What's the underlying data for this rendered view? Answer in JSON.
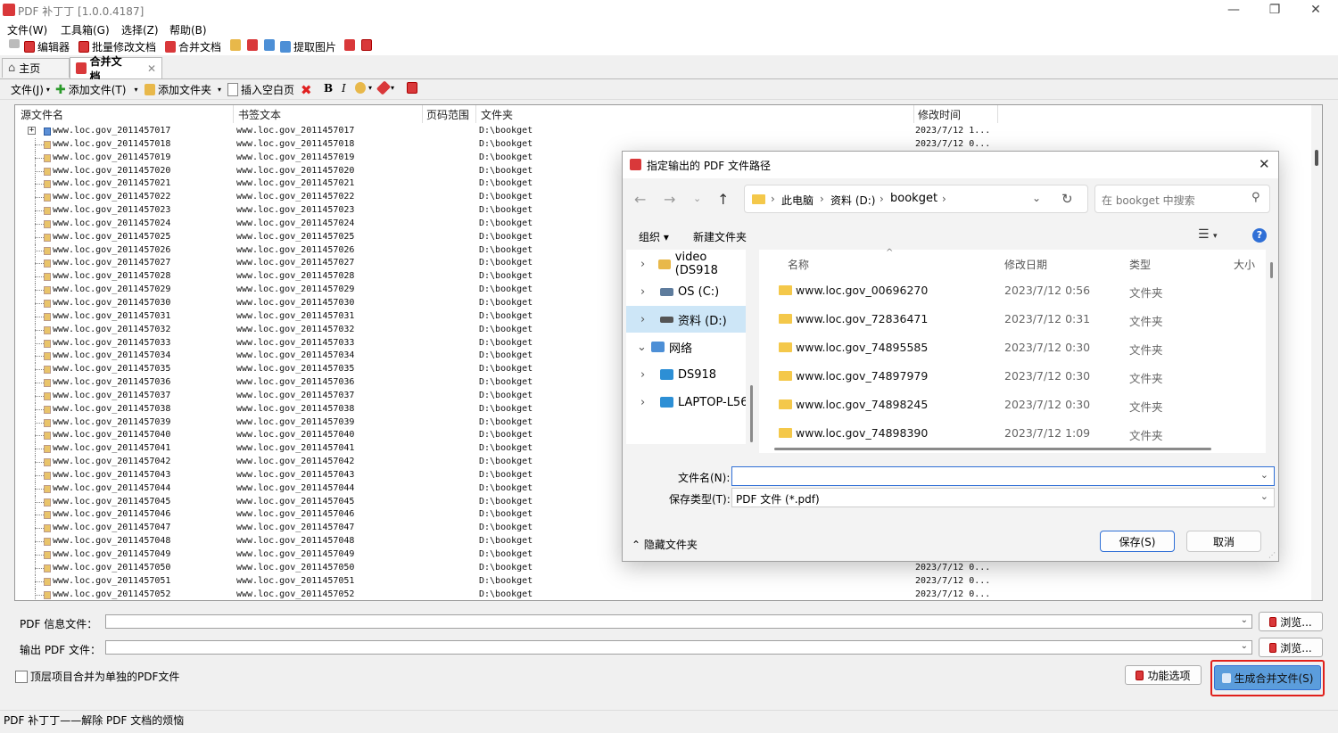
{
  "app": {
    "title": "PDF 补丁丁 [1.0.0.4187]",
    "status": "PDF 补丁丁——解除 PDF 文档的烦恼"
  },
  "menu": [
    "文件(W)",
    "工具箱(G)",
    "选择(Z)",
    "帮助(B)"
  ],
  "toolbar": {
    "editor": "编辑器",
    "batch": "批量修改文档",
    "merge": "合并文档",
    "extract": "提取图片"
  },
  "tabs": {
    "home": "主页",
    "merge": "合并文档"
  },
  "commands": {
    "file": "文件(J)",
    "add_file": "添加文件(T)",
    "add_folder": "添加文件夹",
    "insert_blank": "插入空白页",
    "bold": "B",
    "italic": "I"
  },
  "grid": {
    "headers": {
      "source": "源文件名",
      "bookmark": "书签文本",
      "range": "页码范围",
      "folder": "文件夹",
      "modified": "修改时间"
    },
    "rows": [
      {
        "name": "www.loc.gov_2011457017",
        "bm": "www.loc.gov_2011457017",
        "dir": "D:\\bookget",
        "time": "2023/7/12 1..."
      },
      {
        "name": "www.loc.gov_2011457018",
        "bm": "www.loc.gov_2011457018",
        "dir": "D:\\bookget",
        "time": "2023/7/12 0..."
      },
      {
        "name": "www.loc.gov_2011457019",
        "bm": "www.loc.gov_2011457019",
        "dir": "D:\\bookget",
        "time": ""
      },
      {
        "name": "www.loc.gov_2011457020",
        "bm": "www.loc.gov_2011457020",
        "dir": "D:\\bookget",
        "time": ""
      },
      {
        "name": "www.loc.gov_2011457021",
        "bm": "www.loc.gov_2011457021",
        "dir": "D:\\bookget",
        "time": ""
      },
      {
        "name": "www.loc.gov_2011457022",
        "bm": "www.loc.gov_2011457022",
        "dir": "D:\\bookget",
        "time": ""
      },
      {
        "name": "www.loc.gov_2011457023",
        "bm": "www.loc.gov_2011457023",
        "dir": "D:\\bookget",
        "time": ""
      },
      {
        "name": "www.loc.gov_2011457024",
        "bm": "www.loc.gov_2011457024",
        "dir": "D:\\bookget",
        "time": ""
      },
      {
        "name": "www.loc.gov_2011457025",
        "bm": "www.loc.gov_2011457025",
        "dir": "D:\\bookget",
        "time": ""
      },
      {
        "name": "www.loc.gov_2011457026",
        "bm": "www.loc.gov_2011457026",
        "dir": "D:\\bookget",
        "time": ""
      },
      {
        "name": "www.loc.gov_2011457027",
        "bm": "www.loc.gov_2011457027",
        "dir": "D:\\bookget",
        "time": ""
      },
      {
        "name": "www.loc.gov_2011457028",
        "bm": "www.loc.gov_2011457028",
        "dir": "D:\\bookget",
        "time": ""
      },
      {
        "name": "www.loc.gov_2011457029",
        "bm": "www.loc.gov_2011457029",
        "dir": "D:\\bookget",
        "time": ""
      },
      {
        "name": "www.loc.gov_2011457030",
        "bm": "www.loc.gov_2011457030",
        "dir": "D:\\bookget",
        "time": ""
      },
      {
        "name": "www.loc.gov_2011457031",
        "bm": "www.loc.gov_2011457031",
        "dir": "D:\\bookget",
        "time": ""
      },
      {
        "name": "www.loc.gov_2011457032",
        "bm": "www.loc.gov_2011457032",
        "dir": "D:\\bookget",
        "time": ""
      },
      {
        "name": "www.loc.gov_2011457033",
        "bm": "www.loc.gov_2011457033",
        "dir": "D:\\bookget",
        "time": ""
      },
      {
        "name": "www.loc.gov_2011457034",
        "bm": "www.loc.gov_2011457034",
        "dir": "D:\\bookget",
        "time": ""
      },
      {
        "name": "www.loc.gov_2011457035",
        "bm": "www.loc.gov_2011457035",
        "dir": "D:\\bookget",
        "time": ""
      },
      {
        "name": "www.loc.gov_2011457036",
        "bm": "www.loc.gov_2011457036",
        "dir": "D:\\bookget",
        "time": ""
      },
      {
        "name": "www.loc.gov_2011457037",
        "bm": "www.loc.gov_2011457037",
        "dir": "D:\\bookget",
        "time": ""
      },
      {
        "name": "www.loc.gov_2011457038",
        "bm": "www.loc.gov_2011457038",
        "dir": "D:\\bookget",
        "time": ""
      },
      {
        "name": "www.loc.gov_2011457039",
        "bm": "www.loc.gov_2011457039",
        "dir": "D:\\bookget",
        "time": ""
      },
      {
        "name": "www.loc.gov_2011457040",
        "bm": "www.loc.gov_2011457040",
        "dir": "D:\\bookget",
        "time": ""
      },
      {
        "name": "www.loc.gov_2011457041",
        "bm": "www.loc.gov_2011457041",
        "dir": "D:\\bookget",
        "time": ""
      },
      {
        "name": "www.loc.gov_2011457042",
        "bm": "www.loc.gov_2011457042",
        "dir": "D:\\bookget",
        "time": ""
      },
      {
        "name": "www.loc.gov_2011457043",
        "bm": "www.loc.gov_2011457043",
        "dir": "D:\\bookget",
        "time": ""
      },
      {
        "name": "www.loc.gov_2011457044",
        "bm": "www.loc.gov_2011457044",
        "dir": "D:\\bookget",
        "time": ""
      },
      {
        "name": "www.loc.gov_2011457045",
        "bm": "www.loc.gov_2011457045",
        "dir": "D:\\bookget",
        "time": ""
      },
      {
        "name": "www.loc.gov_2011457046",
        "bm": "www.loc.gov_2011457046",
        "dir": "D:\\bookget",
        "time": ""
      },
      {
        "name": "www.loc.gov_2011457047",
        "bm": "www.loc.gov_2011457047",
        "dir": "D:\\bookget",
        "time": ""
      },
      {
        "name": "www.loc.gov_2011457048",
        "bm": "www.loc.gov_2011457048",
        "dir": "D:\\bookget",
        "time": ""
      },
      {
        "name": "www.loc.gov_2011457049",
        "bm": "www.loc.gov_2011457049",
        "dir": "D:\\bookget",
        "time": ""
      },
      {
        "name": "www.loc.gov_2011457050",
        "bm": "www.loc.gov_2011457050",
        "dir": "D:\\bookget",
        "time": "2023/7/12 0..."
      },
      {
        "name": "www.loc.gov_2011457051",
        "bm": "www.loc.gov_2011457051",
        "dir": "D:\\bookget",
        "time": "2023/7/12 0..."
      },
      {
        "name": "www.loc.gov_2011457052",
        "bm": "www.loc.gov_2011457052",
        "dir": "D:\\bookget",
        "time": "2023/7/12 0..."
      }
    ]
  },
  "bottom": {
    "pdf_info_label": "PDF 信息文件：",
    "output_label": "输出 PDF 文件：",
    "browse": "浏览...",
    "checkbox": "顶层项目合并为单独的PDF文件",
    "options": "功能选项",
    "generate": "生成合并文件(S)"
  },
  "dialog": {
    "title": "指定输出的 PDF 文件路径",
    "path": [
      "此电脑",
      "资料 (D:)",
      "bookget"
    ],
    "search_placeholder": "在 bookget 中搜索",
    "organize": "组织",
    "new_folder": "新建文件夹",
    "nav": [
      "video (DS918",
      "OS (C:)",
      "资料 (D:)",
      "网络",
      "DS918",
      "LAPTOP-L56H"
    ],
    "headers": {
      "name": "名称",
      "date": "修改日期",
      "type": "类型",
      "size": "大小"
    },
    "files": [
      {
        "name": "www.loc.gov_00696270",
        "date": "2023/7/12 0:56",
        "type": "文件夹"
      },
      {
        "name": "www.loc.gov_72836471",
        "date": "2023/7/12 0:31",
        "type": "文件夹"
      },
      {
        "name": "www.loc.gov_74895585",
        "date": "2023/7/12 0:30",
        "type": "文件夹"
      },
      {
        "name": "www.loc.gov_74897979",
        "date": "2023/7/12 0:30",
        "type": "文件夹"
      },
      {
        "name": "www.loc.gov_74898245",
        "date": "2023/7/12 0:30",
        "type": "文件夹"
      },
      {
        "name": "www.loc.gov_74898390",
        "date": "2023/7/12 1:09",
        "type": "文件夹"
      }
    ],
    "filename_label": "文件名(N):",
    "filename_value": "",
    "filetype_label": "保存类型(T):",
    "filetype_value": "PDF 文件 (*.pdf)",
    "hide_folders": "隐藏文件夹",
    "save": "保存(S)",
    "cancel": "取消"
  },
  "colors": {
    "highlight": "#e0201b",
    "accent": "#2f6fd6",
    "selection": "#cde6f7"
  }
}
